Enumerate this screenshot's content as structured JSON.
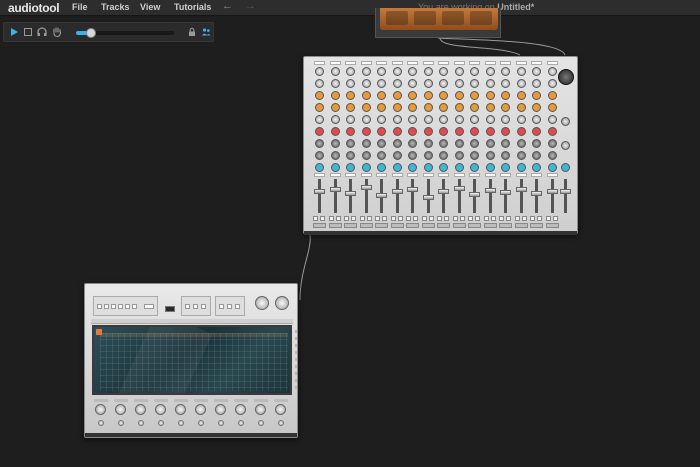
{
  "app": {
    "logo": "audiotool",
    "status_prefix": "You are working on",
    "document_title": "Untitled*"
  },
  "menu": {
    "items": [
      "File",
      "Tracks",
      "View",
      "Tutorials"
    ]
  },
  "navigation": {
    "back": "←",
    "forward": "→"
  },
  "toolbar": {
    "zoom_level": 0.15,
    "tools": [
      "pointer-icon",
      "select-rectangle-icon",
      "headphones-icon",
      "hand-icon",
      "lock-icon",
      "people-icon"
    ]
  },
  "colors": {
    "accent": "#3fb0e5",
    "orange_knob": "#e79a35",
    "red_knob": "#e04b50",
    "cyan_knob": "#3ab8d8",
    "screen_teal": "#1f3a40"
  }
}
